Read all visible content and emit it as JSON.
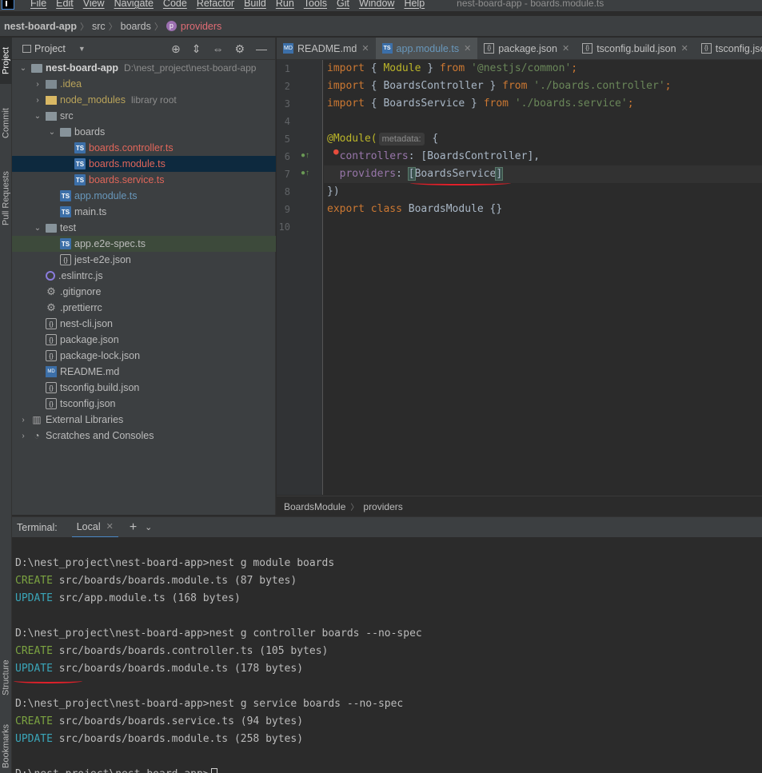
{
  "menu": [
    "File",
    "Edit",
    "View",
    "Navigate",
    "Code",
    "Refactor",
    "Build",
    "Run",
    "Tools",
    "Git",
    "Window",
    "Help"
  ],
  "window_title": "nest-board-app - boards.module.ts",
  "nav_breadcrumb": {
    "project": "nest-board-app",
    "src": "src",
    "boards": "boards",
    "symbol_badge": "p",
    "symbol": "providers"
  },
  "left_tool_tabs": [
    "Project",
    "Commit",
    "Pull Requests",
    "Structure",
    "Bookmarks"
  ],
  "project_panel": {
    "title": "Project",
    "tree": [
      {
        "label": "nest-board-app",
        "hint": "D:\\nest_project\\nest-board-app",
        "depth": 0,
        "arrow": "open",
        "icon": "folder",
        "style": "bold"
      },
      {
        "label": ".idea",
        "depth": 1,
        "arrow": "closed",
        "icon": "folder-idea",
        "style": "yellow"
      },
      {
        "label": "node_modules",
        "hint": "library root",
        "depth": 1,
        "arrow": "closed",
        "icon": "folder-nm",
        "style": "yellow"
      },
      {
        "label": "src",
        "depth": 1,
        "arrow": "open",
        "icon": "folder-src",
        "style": ""
      },
      {
        "label": "boards",
        "depth": 2,
        "arrow": "open",
        "icon": "folder",
        "style": ""
      },
      {
        "label": "boards.controller.ts",
        "depth": 3,
        "arrow": "none",
        "icon": "ts",
        "style": "red"
      },
      {
        "label": "boards.module.ts",
        "depth": 3,
        "arrow": "none",
        "icon": "ts",
        "style": "red",
        "selected": true
      },
      {
        "label": "boards.service.ts",
        "depth": 3,
        "arrow": "none",
        "icon": "ts",
        "style": "red"
      },
      {
        "label": "app.module.ts",
        "depth": 2,
        "arrow": "none",
        "icon": "ts",
        "style": "blue"
      },
      {
        "label": "main.ts",
        "depth": 2,
        "arrow": "none",
        "icon": "ts",
        "style": ""
      },
      {
        "label": "test",
        "depth": 1,
        "arrow": "open",
        "icon": "folder",
        "style": ""
      },
      {
        "label": "app.e2e-spec.ts",
        "depth": 2,
        "arrow": "none",
        "icon": "ts",
        "style": "",
        "highlighted": true
      },
      {
        "label": "jest-e2e.json",
        "depth": 2,
        "arrow": "none",
        "icon": "json",
        "style": ""
      },
      {
        "label": ".eslintrc.js",
        "depth": 1,
        "arrow": "none",
        "icon": "eslint",
        "style": ""
      },
      {
        "label": ".gitignore",
        "depth": 1,
        "arrow": "none",
        "icon": "gear",
        "style": ""
      },
      {
        "label": ".prettierrc",
        "depth": 1,
        "arrow": "none",
        "icon": "gear",
        "style": ""
      },
      {
        "label": "nest-cli.json",
        "depth": 1,
        "arrow": "none",
        "icon": "json",
        "style": ""
      },
      {
        "label": "package.json",
        "depth": 1,
        "arrow": "none",
        "icon": "json",
        "style": ""
      },
      {
        "label": "package-lock.json",
        "depth": 1,
        "arrow": "none",
        "icon": "json",
        "style": ""
      },
      {
        "label": "README.md",
        "depth": 1,
        "arrow": "none",
        "icon": "md",
        "style": ""
      },
      {
        "label": "tsconfig.build.json",
        "depth": 1,
        "arrow": "none",
        "icon": "json",
        "style": ""
      },
      {
        "label": "tsconfig.json",
        "depth": 1,
        "arrow": "none",
        "icon": "json",
        "style": ""
      },
      {
        "label": "External Libraries",
        "depth": 0,
        "arrow": "closed",
        "icon": "lib",
        "style": ""
      },
      {
        "label": "Scratches and Consoles",
        "depth": 0,
        "arrow": "closed",
        "icon": "scratch",
        "style": ""
      }
    ]
  },
  "editor_tabs": [
    {
      "label": "README.md",
      "icon": "md",
      "icon_text": "MD",
      "active": false
    },
    {
      "label": "app.module.ts",
      "icon": "ts",
      "icon_text": "TS",
      "active": true
    },
    {
      "label": "package.json",
      "icon": "js",
      "icon_text": "{}",
      "active": false
    },
    {
      "label": "tsconfig.build.json",
      "icon": "js",
      "icon_text": "{}",
      "active": false
    },
    {
      "label": "tsconfig.json",
      "icon": "js",
      "icon_text": "{}",
      "active": false
    }
  ],
  "code": {
    "line_numbers": [
      "1",
      "2",
      "3",
      "4",
      "5",
      "6",
      "7",
      "8",
      "9",
      "10"
    ],
    "l1": {
      "kw1": "import",
      "p1": " { ",
      "name": "Module",
      "p2": " } ",
      "kw2": "from",
      "sp": " ",
      "str": "'@nestjs/common'",
      "end": ";"
    },
    "l2": {
      "kw1": "import",
      "p1": " { BoardsController } ",
      "kw2": "from",
      "sp": " ",
      "str": "'./boards.controller'",
      "end": ";"
    },
    "l3": {
      "kw1": "import",
      "p1": " { BoardsService } ",
      "kw2": "from",
      "sp": " ",
      "str": "'./boards.service'",
      "end": ";"
    },
    "l5": {
      "ann": "@Module(",
      "inlay": "metadata:",
      "end": " {"
    },
    "l6": {
      "prop": "controllers",
      "rest": ": [BoardsController],"
    },
    "l7": {
      "prop": "providers",
      "colon": ": ",
      "open": "[",
      "name": "BoardsService",
      "close": "]"
    },
    "l8": "})",
    "l9": {
      "kw1": "export",
      "kw2": "class",
      "rest": " BoardsModule {}"
    }
  },
  "editor_breadcrumb": [
    "BoardsModule",
    "providers"
  ],
  "terminal": {
    "label": "Terminal:",
    "tab": "Local",
    "lines": [
      {
        "prompt": "D:\\nest_project\\nest-board-app>nest g module boards"
      },
      {
        "tag": "CREATE",
        "rest": " src/boards/boards.module.ts (87 bytes)",
        "color": "g"
      },
      {
        "tag": "UPDATE",
        "rest": " src/app.module.ts (168 bytes)",
        "color": "c"
      },
      {
        "prompt": ""
      },
      {
        "prompt": "D:\\nest_project\\nest-board-app>nest g controller boards --no-spec"
      },
      {
        "tag": "CREATE",
        "rest": " src/boards/boards.controller.ts (105 bytes)",
        "color": "g"
      },
      {
        "tag": "UPDATE",
        "rest": " src/boards/boards.module.ts (178 bytes)",
        "color": "c"
      },
      {
        "prompt": ""
      },
      {
        "prompt": "D:\\nest_project\\nest-board-app>nest g service boards --no-spec"
      },
      {
        "tag": "CREATE",
        "rest": " src/boards/boards.service.ts (94 bytes)",
        "color": "g"
      },
      {
        "tag": "UPDATE",
        "rest": " src/boards/boards.module.ts (258 bytes)",
        "color": "c"
      },
      {
        "prompt": ""
      },
      {
        "prompt": "D:\\nest_project\\nest-board-app>"
      }
    ]
  }
}
